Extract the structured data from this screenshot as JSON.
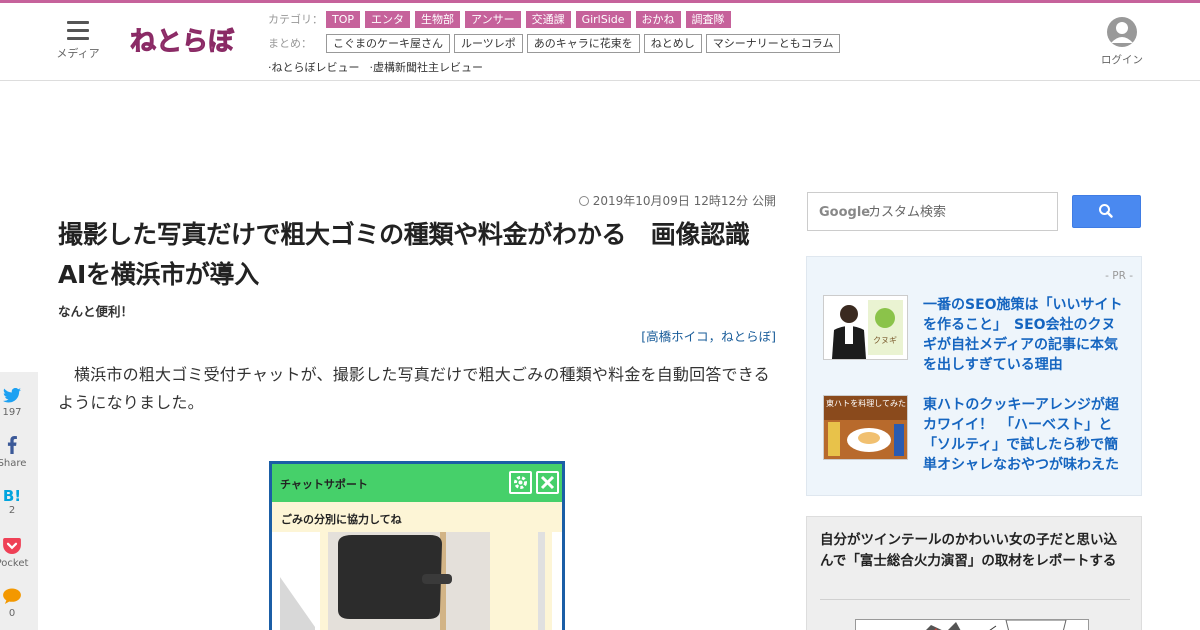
{
  "header": {
    "menu_label": "メディア",
    "logo_text": "ねとらぼ",
    "category_label": "カテゴリ：",
    "categories": [
      "TOP",
      "エンタ",
      "生物部",
      "アンサー",
      "交通課",
      "GirlSide",
      "おかね",
      "調査隊"
    ],
    "matome_label": "まとめ：",
    "matome": [
      "こぐまのケーキ屋さん",
      "ルーツレポ",
      "あのキャラに花束を",
      "ねとめし",
      "マシーナリーともコラム"
    ],
    "reviews": [
      "·ねとらぼレビュー",
      "·虚構新聞社主レビュー"
    ],
    "login_label": "ログイン"
  },
  "share": {
    "twitter_count": "197",
    "facebook_label": "Share",
    "hatena_label": "B!",
    "hatena_count": "2",
    "pocket_label": "Pocket",
    "comment_count": "0"
  },
  "article": {
    "date": "2019年10月09日 12時12分 公開",
    "title": "撮影した写真だけで粗大ゴミの種類や料金がわかる　画像認識AIを横浜市が導入",
    "subtitle": "なんと便利！",
    "byline": "[高橋ホイコ，ねとらぼ]",
    "body": "横浜市の粗大ゴミ受付チャットが、撮影した写真だけで粗大ごみの種類や料金を自動回答できるようになりました。",
    "screenshot": {
      "header_text": "チャットサポート",
      "message": "ごみの分別に協力してね"
    }
  },
  "sidebar": {
    "search_placeholder": "カスタム検索",
    "search_brand": "Google",
    "pr_label": "- PR -",
    "pr_items": [
      {
        "text": "一番のSEO施策は「いいサイトを作ること」　SEO会社のクヌギが自社メディアの記事に本気を出しすぎている理由",
        "thumb_text": "クヌギ"
      },
      {
        "text": "東ハトのクッキーアレンジが超カワイイ！　「ハーベスト」と「ソルティ」で試したら秒で簡単オシャレなおやつが味わえた",
        "thumb_text": "東ハトを料理してみた"
      }
    ],
    "ranking_text": "自分がツインテールのかわいい女の子だと思い込んで「富士総合火力演習」の取材をレポートする"
  },
  "colors": {
    "brand": "#c6629b",
    "link": "#1565c0",
    "chat_green": "#46d06a",
    "search_button": "#4a89f0"
  }
}
